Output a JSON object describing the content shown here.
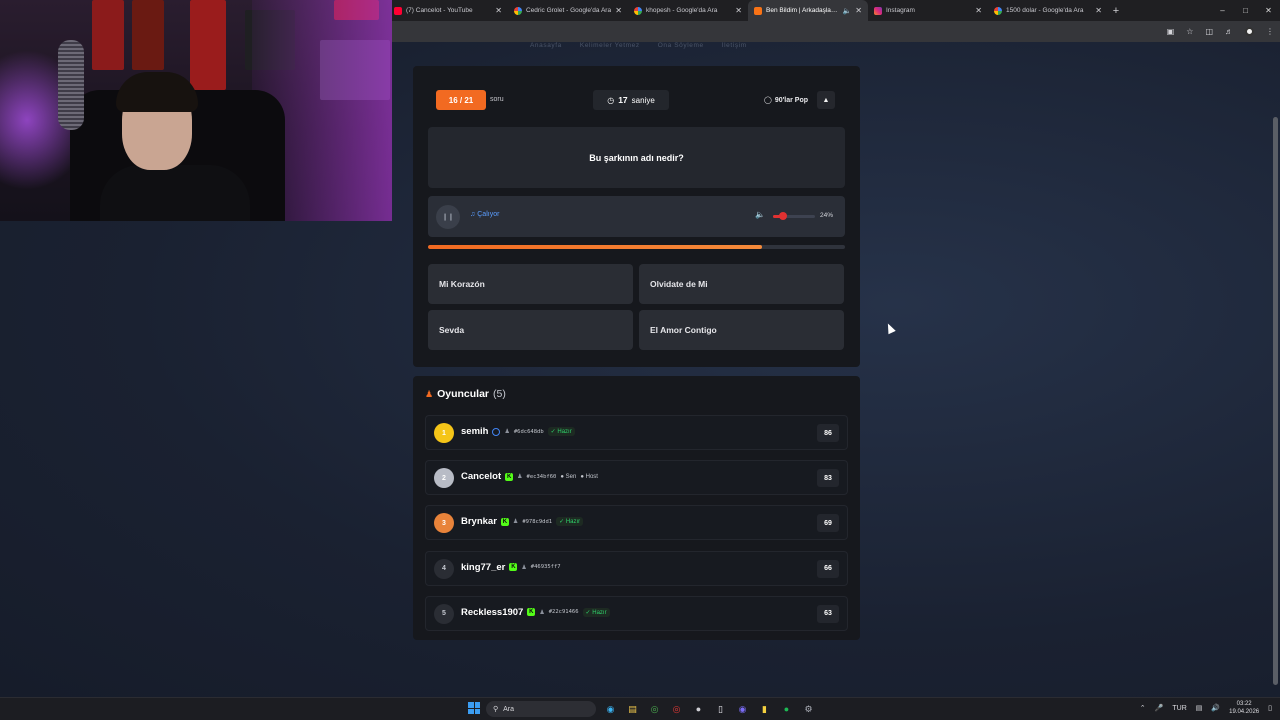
{
  "browser": {
    "tabs": [
      {
        "title": "(7) Cancelot - YouTube",
        "favicon": "youtube-icon",
        "active": false
      },
      {
        "title": "Cedric Grolet - Google'da Ara",
        "favicon": "google-icon",
        "active": false
      },
      {
        "title": "khopesh - Google'da Ara",
        "favicon": "google-icon",
        "active": false
      },
      {
        "title": "Ben Bildim | Arkadaşlarınla",
        "favicon": "site-icon",
        "active": true
      },
      {
        "title": "Instagram",
        "favicon": "instagram-icon",
        "active": false
      },
      {
        "title": "1500 dolar - Google'da Ara",
        "favicon": "google-icon",
        "active": false
      }
    ]
  },
  "nav": {
    "items": [
      "Anasayfa",
      "Kelimeler Yetmez",
      "Ona Söyleme",
      "İletişim"
    ]
  },
  "quiz": {
    "counter": "16 / 21",
    "counter_suffix": "soru",
    "timer_value": "17",
    "timer_unit": "saniye",
    "genre": "90'lar Pop",
    "question": "Bu şarkının adı nedir?",
    "status": "Çalıyor",
    "volume_label": "24%",
    "volume_fraction": 0.24,
    "progress_fraction": 0.8,
    "options": [
      "Mi Korazón",
      "Olvidate de Mi",
      "Sevda",
      "El Amor Contigo"
    ]
  },
  "players": {
    "title": "Oyuncular",
    "count": "(5)",
    "list": [
      {
        "rank": "1",
        "name": "semih",
        "platform": "google",
        "hash": "#6dc648db",
        "tags": [
          "Hazır"
        ],
        "score": "86",
        "rank_color": "#f5c518"
      },
      {
        "rank": "2",
        "name": "Cancelot",
        "platform": "kick",
        "hash": "#ec34bf60",
        "tags": [
          "Sen",
          "Host"
        ],
        "score": "83",
        "rank_color": "#b8bcc6"
      },
      {
        "rank": "3",
        "name": "Brynkar",
        "platform": "kick",
        "hash": "#978c9dd1",
        "tags": [
          "Hazır"
        ],
        "score": "69",
        "rank_color": "#e8833a"
      },
      {
        "rank": "4",
        "name": "king77_er",
        "platform": "kick",
        "hash": "#46935ff7",
        "tags": [],
        "score": "66",
        "rank_color": "#2a2d34"
      },
      {
        "rank": "5",
        "name": "Reckless1907",
        "platform": "kick",
        "hash": "#22c91466",
        "tags": [
          "Hazır"
        ],
        "score": "63",
        "rank_color": "#2a2d34"
      }
    ]
  },
  "taskbar": {
    "search_placeholder": "Ara",
    "language": "TUR",
    "time": "03:22",
    "date": "19.04.2026"
  },
  "colors": {
    "accent": "#f26a21",
    "ready": "#2fd36b",
    "kick": "#53fc18",
    "volume": "#e03131"
  }
}
